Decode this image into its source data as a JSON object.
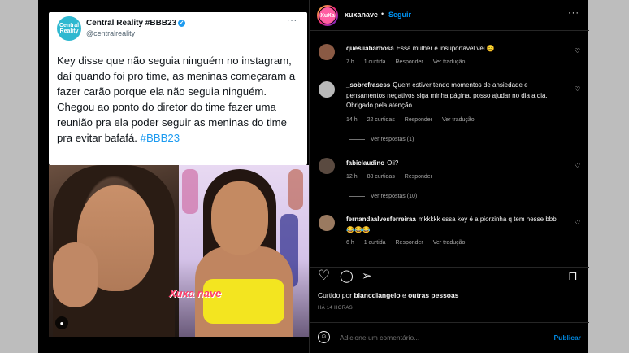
{
  "tweet": {
    "avatar_text": "Central Reality",
    "name": "Central Reality #BBB23",
    "verified_glyph": "✓",
    "handle": "@centralreality",
    "more": "···",
    "text": "Key disse que não seguia ninguém no instagram, daí quando foi pro time, as meninas começaram a fazer carão porque ela não seguia ninguém. Chegou ao ponto do diretor do time fazer uma reunião pra ela poder seguir as meninas do time pra evitar bafafá.",
    "hashtag": "#BBB23"
  },
  "photo": {
    "logo_text": "Xuxa nave",
    "user_tag_icon": "user-icon"
  },
  "header": {
    "avatar_text": "XuXa",
    "username": "xuxanave",
    "separator": "•",
    "follow_label": "Seguir",
    "more": "···"
  },
  "comments": [
    {
      "user": "quesiiabarbosa",
      "text": "Essa mulher é insuportável véi 😑",
      "time": "7 h",
      "likes": "1 curtida",
      "reply": "Responder",
      "translate": "Ver tradução",
      "avatar_color": "#8a5a44"
    },
    {
      "user": "_sobrefrasess",
      "text": "Quem estiver tendo momentos de ansiedade e pensamentos negativos siga minha página, posso ajudar no dia a dia. Obrigado pela atenção",
      "time": "14 h",
      "likes": "22 curtidas",
      "reply": "Responder",
      "translate": "Ver tradução",
      "replies": "Ver respostas (1)",
      "avatar_color": "#b9b9b9"
    },
    {
      "user": "fabiclaudino",
      "text": "Oii?",
      "time": "12 h",
      "likes": "88 curtidas",
      "reply": "Responder",
      "replies": "Ver respostas (10)",
      "avatar_color": "#5a4a40"
    },
    {
      "user": "fernandaalvesferreiraa",
      "text": "mkkkkk essa key é a piorzinha q tem nesse bbb 😂😂😂",
      "time": "6 h",
      "likes": "1 curtida",
      "reply": "Responder",
      "translate": "Ver tradução",
      "avatar_color": "#9a7a60"
    }
  ],
  "actions": {
    "like_icon": "♡",
    "comment_icon": "◯",
    "share_icon": "➢",
    "save_icon": "⊓"
  },
  "liked_by": {
    "prefix": "Curtido por",
    "user": "biancdiangelo",
    "connector": "e",
    "others": "outras pessoas"
  },
  "time_ago": "HÁ 14 HORAS",
  "add_comment": {
    "emoji_icon": "☺",
    "placeholder": "Adicione um comentário...",
    "publish_label": "Publicar"
  },
  "colors": {
    "accent": "#0095f6",
    "background": "#000000",
    "twitter_blue": "#1d9bf0"
  }
}
